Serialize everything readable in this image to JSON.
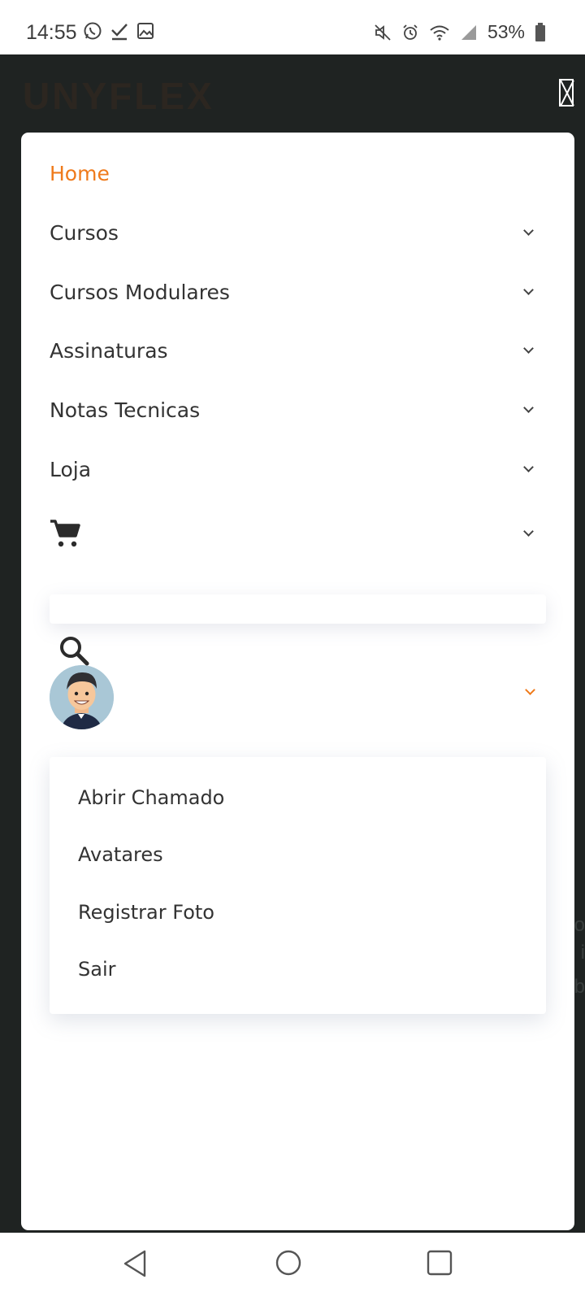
{
  "status_bar": {
    "time": "14:55",
    "battery": "53%",
    "left_icons": [
      "whatsapp-icon",
      "check-icon",
      "image-icon"
    ],
    "right_icons": [
      "mute-icon",
      "alarm-icon",
      "wifi-icon",
      "signal-icon",
      "battery-icon"
    ]
  },
  "header": {
    "logo": "UNYFLEX"
  },
  "menu": {
    "items": [
      {
        "label": "Home",
        "active": true
      },
      {
        "label": "Cursos"
      },
      {
        "label": "Cursos Modulares"
      },
      {
        "label": "Assinaturas"
      },
      {
        "label": "Notas Tecnicas"
      },
      {
        "label": "Loja"
      }
    ],
    "cart_icon": "cart-icon"
  },
  "search": {
    "placeholder": ""
  },
  "user_menu": {
    "items": [
      "Abrir Chamado",
      "Avatares",
      "Registrar Foto",
      "Sair"
    ]
  },
  "colors": {
    "accent": "#ef7a1b",
    "background": "#1f2322",
    "text": "#333333"
  }
}
